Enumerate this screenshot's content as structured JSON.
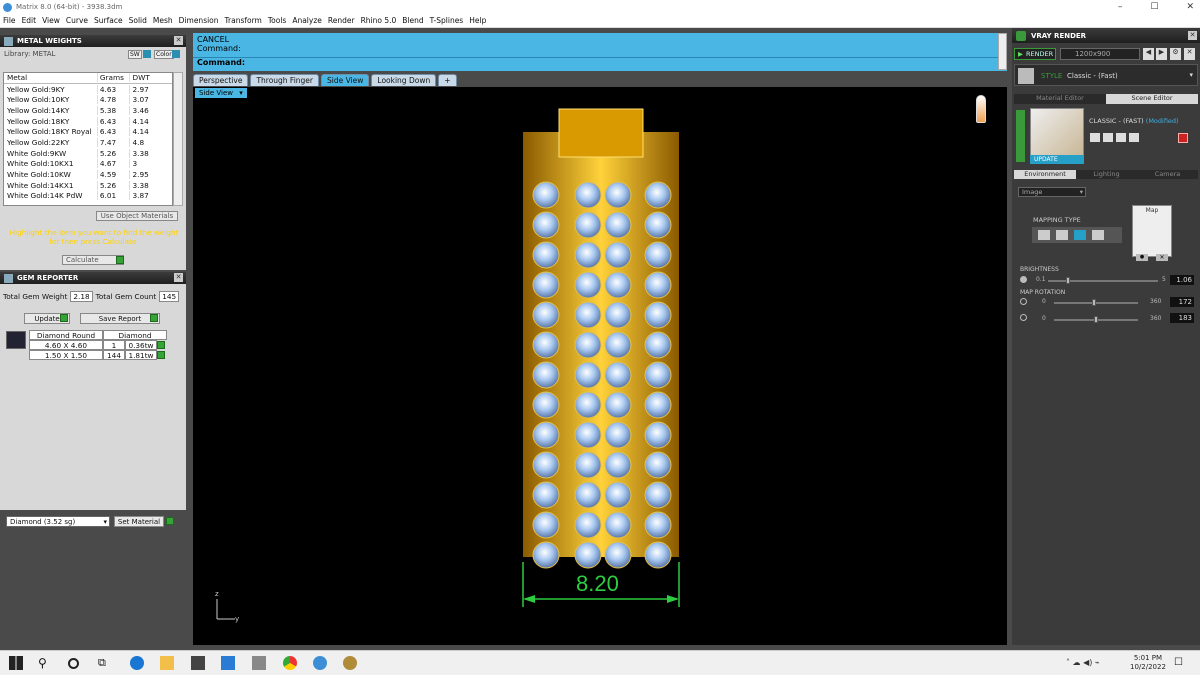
{
  "window": {
    "title": "Matrix 8.0 (64-bit) - 3938.3dm",
    "controls": [
      "–",
      "☐",
      "✕"
    ]
  },
  "menu": [
    "File",
    "Edit",
    "View",
    "Curve",
    "Surface",
    "Solid",
    "Mesh",
    "Dimension",
    "Transform",
    "Tools",
    "Analyze",
    "Render",
    "Rhino 5.0",
    "Blend",
    "T-Splines",
    "Help"
  ],
  "metal_weights": {
    "title": "METAL WEIGHTS",
    "library_label": "Library: METAL",
    "sw_label": "SW",
    "color_label": "Color",
    "columns": [
      "Metal",
      "Grams",
      "DWT"
    ],
    "rows": [
      [
        "Yellow Gold:9KY",
        "4.63",
        "2.97"
      ],
      [
        "Yellow Gold:10KY",
        "4.78",
        "3.07"
      ],
      [
        "Yellow Gold:14KY",
        "5.38",
        "3.46"
      ],
      [
        "Yellow Gold:18KY",
        "6.43",
        "4.14"
      ],
      [
        "Yellow Gold:18KY Royal",
        "6.43",
        "4.14"
      ],
      [
        "Yellow Gold:22KY",
        "7.47",
        "4.8"
      ],
      [
        "White Gold:9KW",
        "5.26",
        "3.38"
      ],
      [
        "White Gold:10KX1",
        "4.67",
        "3"
      ],
      [
        "White Gold:10KW",
        "4.59",
        "2.95"
      ],
      [
        "White Gold:14KX1",
        "5.26",
        "3.38"
      ],
      [
        "White Gold:14K PdW",
        "6.01",
        "3.87"
      ]
    ],
    "use_object_materials": "Use Object Materials",
    "hint": "Highlight the item you want to find the weight for then press Calculate.",
    "calculate": "Calculate"
  },
  "gem_reporter": {
    "title": "GEM REPORTER",
    "total_weight_label": "Total Gem Weight",
    "total_weight": "2.18",
    "total_count_label": "Total Gem Count",
    "total_count": "145",
    "update": "Update",
    "save_report": "Save Report",
    "columns": [
      "Diamond Round",
      "Diamond"
    ],
    "rows": [
      {
        "size": "4.60 X 4.60",
        "qty": "1",
        "tw": "0.36tw"
      },
      {
        "size": "1.50 X 1.50",
        "qty": "144",
        "tw": "1.81tw"
      }
    ],
    "material_select": "Diamond   (3.52 sg)",
    "set_material": "Set Material"
  },
  "command": {
    "line1": "CANCEL",
    "line2": "Command:",
    "prompt": "Command:"
  },
  "view_tabs": [
    "Perspective",
    "Through Finger",
    "Side View",
    "Looking Down"
  ],
  "active_tab": "Side View",
  "viewport_label": "Side View",
  "dimension": "8.20",
  "axis": {
    "z": "z",
    "y": "y"
  },
  "vray": {
    "title": "VRAY RENDER",
    "render": "RENDER",
    "resolution": "1200x900",
    "style_label": "STYLE",
    "style_value": "Classic - (Fast)",
    "tabs": [
      "Material Editor",
      "Scene Editor"
    ],
    "preset_name": "CLASSIC - (FAST)",
    "preset_status": "(Modified)",
    "update": "UPDATE",
    "env_tabs": [
      "Environment",
      "Lighting",
      "Camera"
    ],
    "env_source": "Image",
    "mapping_type": "MAPPING TYPE",
    "map_label": "Map",
    "brightness": {
      "label": "BRIGHTNESS",
      "min": "0.1",
      "max": "5",
      "value": "1.06"
    },
    "map_rotation": {
      "label": "MAP ROTATION",
      "row1": {
        "min": "0",
        "max": "360",
        "value": "172"
      },
      "row2": {
        "min": "0",
        "max": "360",
        "value": "183"
      }
    }
  },
  "taskbar": {
    "time": "5:01 PM",
    "date": "10/2/2022"
  }
}
